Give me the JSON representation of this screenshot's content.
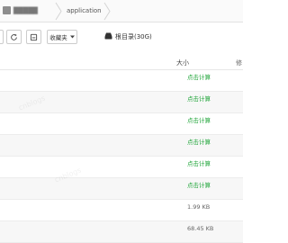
{
  "breadcrumb": {
    "items": [
      "█████",
      "application"
    ]
  },
  "toolbar": {
    "favorites_label": "收藏夹",
    "root_label": "根目录(30G)"
  },
  "table": {
    "columns": {
      "size": "大小",
      "next": "修"
    },
    "rows": [
      {
        "size": "点击计算",
        "kind": "calc"
      },
      {
        "size": "点击计算",
        "kind": "calc"
      },
      {
        "size": "点击计算",
        "kind": "calc"
      },
      {
        "size": "点击计算",
        "kind": "calc"
      },
      {
        "size": "点击计算",
        "kind": "calc"
      },
      {
        "size": "点击计算",
        "kind": "calc"
      },
      {
        "size": "1.99 KB",
        "kind": "val"
      },
      {
        "size": "68.45 KB",
        "kind": "val"
      }
    ]
  },
  "colors": {
    "calc_link": "#20a53a",
    "border": "#e3e3e3",
    "alt_row": "#f7f7f7"
  },
  "icons": {
    "breadcrumb": "folder-icon",
    "refresh": "refresh-icon",
    "history": "history-icon",
    "dropdown": "chevron-down-icon",
    "disk": "disk-icon"
  }
}
